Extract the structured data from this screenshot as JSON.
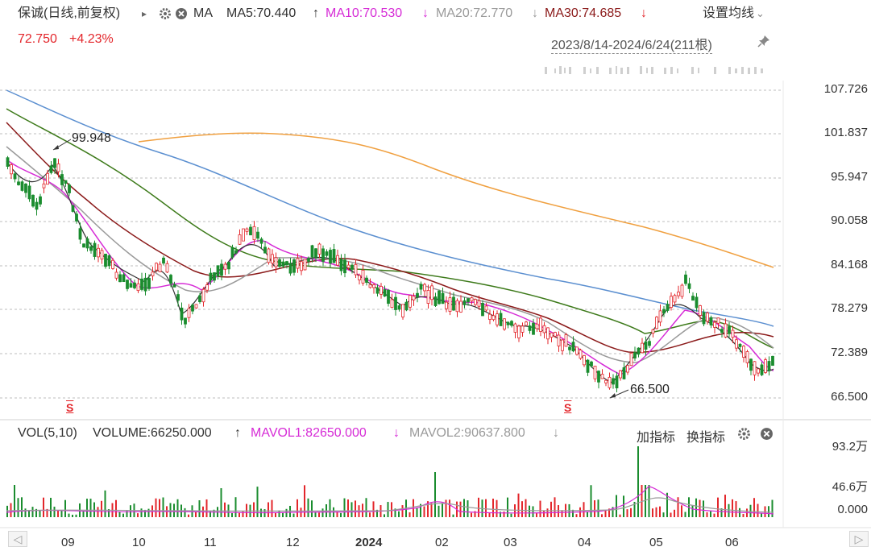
{
  "header": {
    "stock_name": "保诚(日线,前复权)",
    "play_icon": "▸",
    "indicator": "MA",
    "ma5": "MA5:70.440",
    "ma5_arrow": "↑",
    "ma10": "MA10:70.530",
    "ma10_arrow": "↓",
    "ma20": "MA20:72.770",
    "ma20_arrow": "↓",
    "ma30": "MA30:74.685",
    "ma30_arrow": "↓",
    "settings_label": "设置均线",
    "settings_chevron": "⌄",
    "price": "72.750",
    "change": "+4.23%",
    "date_range": "2023/8/14-2024/6/24(211根)"
  },
  "price_axis": [
    "107.726",
    "101.837",
    "95.947",
    "90.058",
    "84.168",
    "78.279",
    "72.389",
    "66.500"
  ],
  "annotations": {
    "high": "99.948",
    "low": "66.500",
    "marker_1": "S",
    "marker_2": "S"
  },
  "volume": {
    "label": "VOL(5,10)",
    "volume": "VOLUME:66250.000",
    "volume_arrow": "↑",
    "mavol1": "MAVOL1:82650.000",
    "mavol1_arrow": "↓",
    "mavol2": "MAVOL2:90637.800",
    "mavol2_arrow": "↓",
    "add_indicator": "加指标",
    "switch_indicator": "换指标",
    "axis": [
      "93.2万",
      "46.6万",
      "0.000"
    ]
  },
  "x_axis": [
    "09",
    "10",
    "11",
    "12",
    "2024",
    "02",
    "03",
    "04",
    "05",
    "06"
  ],
  "scroll": {
    "left": "◁",
    "right": "▷"
  },
  "colors": {
    "up": "#e3262b",
    "down": "#1a8c2e",
    "ma5": "#333333",
    "ma10": "#d62bd6",
    "ma20": "#9a9a9a",
    "ma30": "#8b1a1a",
    "ma60": "#3d7a1a",
    "ma120": "#5b8fd0",
    "ma250": "#f0a040"
  },
  "chart_data": {
    "type": "line",
    "title": "保诚(日线,前复权)",
    "ylim": [
      66.5,
      107.726
    ],
    "categories": [
      "09",
      "10",
      "11",
      "12",
      "2024",
      "02",
      "03",
      "04",
      "05",
      "06"
    ],
    "series": [
      {
        "name": "MA5",
        "values": [
          96.0,
          88.0,
          82.0,
          88.0,
          82.0,
          79.0,
          76.0,
          68.0,
          80.0,
          70.4
        ]
      },
      {
        "name": "MA10",
        "values": [
          95.0,
          88.5,
          81.5,
          87.0,
          83.0,
          79.0,
          76.5,
          69.0,
          78.0,
          70.5
        ]
      },
      {
        "name": "MA20",
        "values": [
          96.0,
          90.0,
          82.0,
          86.0,
          83.5,
          80.0,
          77.0,
          70.5,
          77.0,
          72.8
        ]
      },
      {
        "name": "MA30",
        "values": [
          97.0,
          91.0,
          83.0,
          85.0,
          84.5,
          80.5,
          78.0,
          72.0,
          76.0,
          74.7
        ]
      }
    ],
    "annotations": {
      "high": 99.948,
      "low": 66.5
    }
  }
}
